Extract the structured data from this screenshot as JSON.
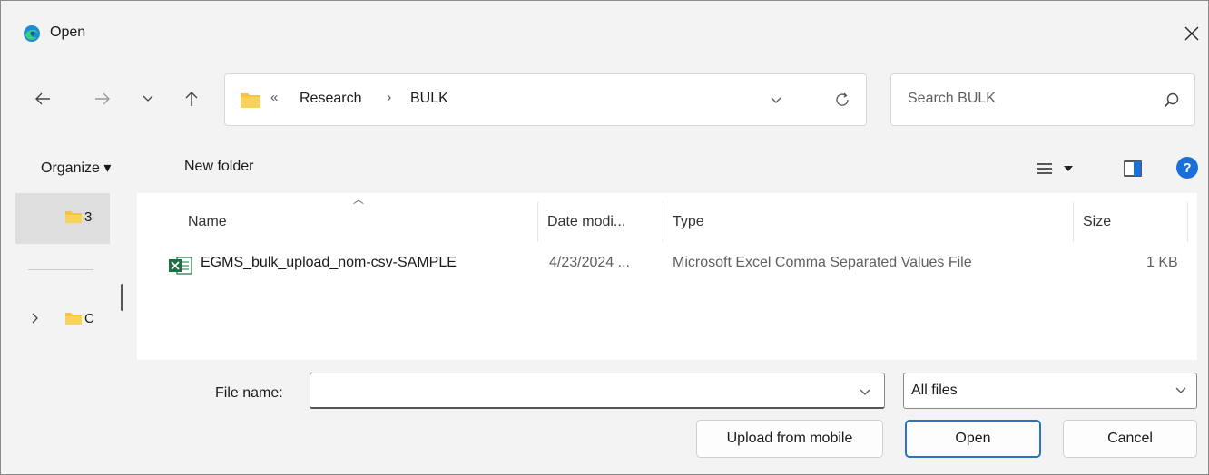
{
  "window": {
    "title": "Open"
  },
  "address": {
    "breadcrumb_overflow": "«",
    "segments": [
      "Research",
      "BULK"
    ],
    "separator": "›"
  },
  "search": {
    "placeholder": "Search BULK"
  },
  "toolbar": {
    "organize_label": "Organize ▾",
    "new_folder_label": "New folder"
  },
  "navpane": {
    "items": [
      "3",
      "C"
    ]
  },
  "filelist": {
    "columns": [
      "Name",
      "Date modi...",
      "Type",
      "Size"
    ],
    "rows": [
      {
        "name": "EGMS_bulk_upload_nom-csv-SAMPLE",
        "date": "4/23/2024 ...",
        "type": "Microsoft Excel Comma Separated Values File",
        "size": "1 KB",
        "icon": "excel-csv-icon"
      }
    ]
  },
  "bottom": {
    "filename_label": "File name:",
    "filename_value": "",
    "filetype_value": "All files",
    "upload_label": "Upload from mobile",
    "open_label": "Open",
    "cancel_label": "Cancel"
  },
  "colors": {
    "accent": "#2a73c8",
    "help": "#1a6fd8",
    "folder": "#f5c542",
    "excel": "#1d7044"
  }
}
